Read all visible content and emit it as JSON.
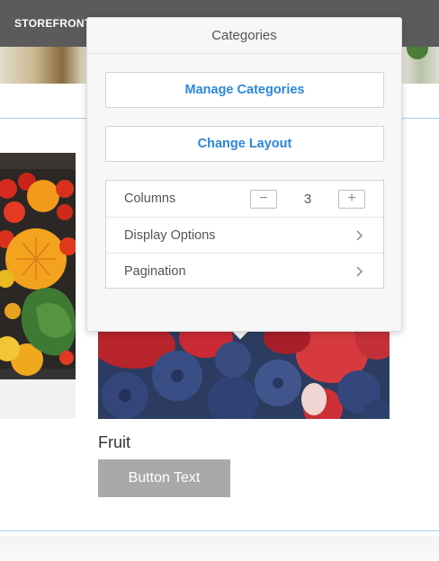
{
  "header": {
    "brand": "STOREFRONT"
  },
  "popover": {
    "title": "Categories",
    "manage_button": "Manage Categories",
    "layout_button": "Change Layout",
    "settings": {
      "columns_label": "Columns",
      "columns_value": "3",
      "decrement_symbol": "−",
      "increment_symbol": "+",
      "display_options_label": "Display Options",
      "pagination_label": "Pagination"
    }
  },
  "product": {
    "title": "Fruit",
    "button_label": "Button Text"
  },
  "colors": {
    "accent": "#2b87d9",
    "divider": "#a9cdf0",
    "button_gray": "#a9a9a9"
  },
  "icons": {
    "chevron": "chevron-right-icon",
    "minus": "minus-icon",
    "plus": "plus-icon"
  }
}
